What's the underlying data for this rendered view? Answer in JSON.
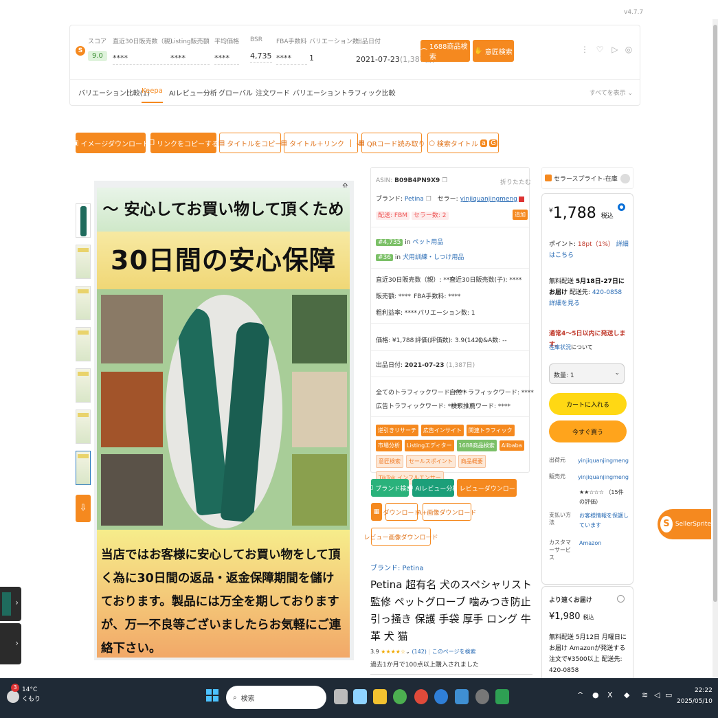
{
  "version": "v4.7.7",
  "topbar": {
    "logo": "S",
    "metrics": [
      {
        "label": "スコア",
        "value": "9.0",
        "style": "score"
      },
      {
        "label": "直近30日販売数（親）",
        "value": "****"
      },
      {
        "label": "Listing販売額",
        "value": "****"
      },
      {
        "label": "平均価格",
        "value": "****"
      },
      {
        "label": "BSR",
        "value": "4,735"
      },
      {
        "label": "FBA手数料",
        "value": "****"
      },
      {
        "label": "バリエーション数",
        "value": "1"
      },
      {
        "label": "出品日付",
        "value": "2021-07-23",
        "extra": "(1,387日)"
      }
    ],
    "btn_1688": "1688商品検索",
    "btn_design": "意匠検索",
    "tabs": [
      "バリエーション比較(1)",
      "Keepa",
      "AIレビュー分析",
      "グローバル",
      "注文ワード",
      "バリエーショントラフィック比較"
    ],
    "tab_more": "すべてを表示"
  },
  "toolbar": {
    "download_image": "イメージダウンロード",
    "copy_link": "リンクをコピーする",
    "copy_title": "タイトルをコピー",
    "title_link": "タイトル＋リンク",
    "qr": "QRコード読み取り",
    "search_title": "検索タイトル"
  },
  "hero": {
    "heading": "～ 安心してお買い物して頂くために ～",
    "guarantee": "30日間の安心保障 !!",
    "body": "当店ではお客様に安心してお買い物をして頂く為に30日間の返品・返金保障期間を儲けております。製品には万全を期しておりますが、万一不良等ございましたらお気軽にご連絡下さい。"
  },
  "info": {
    "asin_label": "ASIN:",
    "asin": "B09B4PN9X9",
    "collapse": "折りたたむ",
    "brand_label": "ブランド:",
    "brand": "Petina",
    "seller_label": "セラー:",
    "seller": "yinjiquanjingmeng",
    "delivery": "配送: FBM",
    "seller_count": "セラー数: 2",
    "add": "追加",
    "rank1": "#4,735",
    "rank1_in": "in",
    "rank1_cat": "ペット用品",
    "rank2": "#36",
    "rank2_in": "in",
    "rank2_cat": "犬用訓練・しつけ用品",
    "sales_parent": "直近30日販売数（親）: ****",
    "sales_child": "直近30日販売数(子): ****",
    "revenue": "販売額: ****",
    "fba": "FBA手数料: ****",
    "margin": "粗利益率: ****",
    "variations": "バリエーション数: 1",
    "price": "価格: ¥1,788",
    "rating": "評価(評価数): 3.9(142)",
    "qa": "Q&A数: --",
    "launch_label": "出品日付:",
    "launch_date": "2021-07-23",
    "launch_days": "(1,387日)",
    "all_traffic": "全てのトラフィックワード: ****",
    "natural_traffic": "自然トラフィックワード: ****",
    "ad_traffic": "広告トラフィックワード: ****",
    "recommend": "検索推薦ワード: ****",
    "pills": [
      {
        "text": "逆引きリサーチ",
        "kind": "o"
      },
      {
        "text": "広告インサイト",
        "kind": "o"
      },
      {
        "text": "関連トラフィック",
        "kind": "o"
      },
      {
        "text": "市場分析",
        "kind": "o"
      },
      {
        "text": "Listingエディター",
        "kind": "o"
      },
      {
        "text": "1688商品検索",
        "kind": "g"
      },
      {
        "text": "Alibaba",
        "kind": "o"
      },
      {
        "text": "意匠検索",
        "kind": "lo"
      },
      {
        "text": "セールスポイント",
        "kind": "lo"
      },
      {
        "text": "商品概要",
        "kind": "lo"
      },
      {
        "text": "TikTok インフルエンサー",
        "kind": "lo"
      }
    ]
  },
  "actions": {
    "brand": "ブランド検出",
    "ai": "AIレビュー分析",
    "review_dl": "レビューダウンロード",
    "download": "ダウンロード",
    "aplus": "A+画像ダウンロード",
    "review_img": "レビュー画像ダウンロード"
  },
  "product": {
    "brand_line": "ブランド: Petina",
    "title": "Petina 超有名 犬のスペシャリスト監修 ペットグローブ 噛みつき防止 引っ掻き 保護 手袋 厚手 ロング 牛革 犬 猫",
    "rating": "3.9",
    "stars": "★★★★☆",
    "reviews": "(142)",
    "search_page": "このページを検索",
    "bought": "過去1か月で100点以上購入されました"
  },
  "sidecard": {
    "title": "セラースプライト-在庫"
  },
  "buybox": {
    "currency": "¥",
    "price": "1,788",
    "tax": "税込",
    "points_label": "ポイント:",
    "points": "18pt（1%）",
    "points_detail": "詳細はこちら",
    "free_ship": "無料配送",
    "ship_dates": "5月18日-27日にお届け",
    "ship_to": "配送先:",
    "zip": "420-0858",
    "detail": "詳細を見る",
    "dispatch": "通常4～5日以内に発送します。",
    "stock_link": "在庫状況",
    "stock_suffix": "について",
    "qty": "数量: 1",
    "add_cart": "カートに入れる",
    "buy_now": "今すぐ買う",
    "rows": [
      {
        "k": "出荷元",
        "v": "yinjiquanjingmeng"
      },
      {
        "k": "販売元",
        "v": "yinjiquanjingmeng"
      },
      {
        "k": "",
        "v": "★★☆☆☆ （15件の評価）",
        "dark": true
      },
      {
        "k": "支払い方法",
        "v": "お客様情報を保護しています"
      },
      {
        "k": "カスタマーサービス",
        "v": "Amazon"
      }
    ]
  },
  "fast": {
    "heading": "より速くお届け",
    "price": "¥1,980",
    "tax": "税込",
    "text": "無料配送 5月12日 月曜日にお届け Amazonが発送する注文で¥3500以上 配送先: 420-0858"
  },
  "sellersprite_badge": "SellerSprite",
  "taskbar": {
    "weather_badge": "3",
    "temp": "14°C",
    "condition": "くもり",
    "search": "検索",
    "time": "22:22",
    "date": "2025/05/10"
  }
}
